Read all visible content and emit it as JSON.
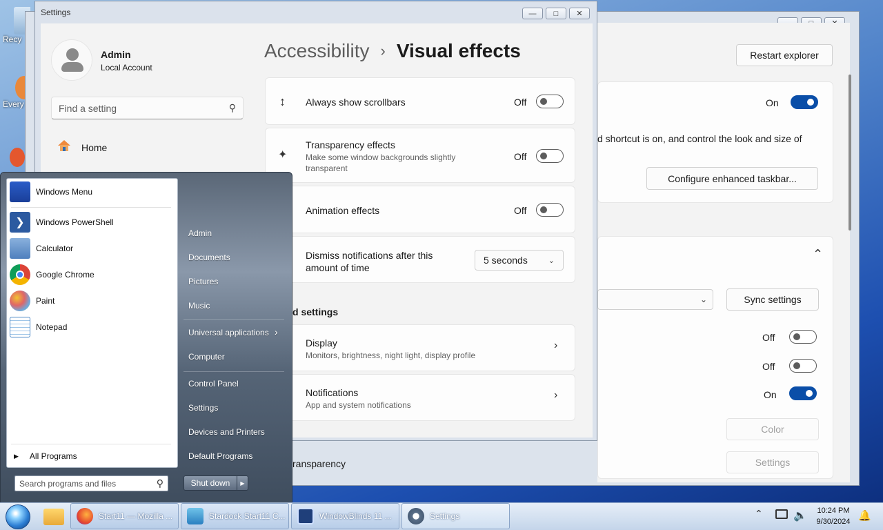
{
  "desktop": {
    "icons": [
      {
        "label": "Recy"
      },
      {
        "label": "Every"
      }
    ]
  },
  "back_window": {
    "restart_label": "Restart explorer",
    "toggle1_state": "On",
    "desc_text": "d shortcut is on, and control the look and size of",
    "configure_label": "Configure enhanced taskbar...",
    "sync_label": "Sync settings",
    "row1_state": "Off",
    "row2_state": "Off",
    "row3_state": "On",
    "color_label": "Color",
    "settings_label": "Settings",
    "transparency_label": "ransparency",
    "section_label": "d settings"
  },
  "settings": {
    "window_title": "Settings",
    "user": {
      "name": "Admin",
      "account": "Local Account"
    },
    "search": {
      "placeholder": "Find a setting"
    },
    "nav": {
      "home": "Home"
    },
    "breadcrumb": {
      "parent": "Accessibility",
      "sep": "›",
      "current": "Visual effects"
    },
    "rows": [
      {
        "title": "Always show scrollbars",
        "state": "Off"
      },
      {
        "title": "Transparency effects",
        "subtitle": "Make some window backgrounds slightly transparent",
        "state": "Off"
      },
      {
        "title": "Animation effects",
        "state": "Off"
      },
      {
        "title": "Dismiss notifications after this amount of time",
        "value": "5 seconds"
      }
    ],
    "related": [
      {
        "title": "Display",
        "subtitle": "Monitors, brightness, night light, display profile"
      },
      {
        "title": "Notifications",
        "subtitle": "App and system notifications"
      }
    ]
  },
  "start_menu": {
    "pinned": [
      {
        "label": "Windows Menu"
      },
      {
        "label": "Windows PowerShell"
      },
      {
        "label": "Calculator"
      },
      {
        "label": "Google Chrome"
      },
      {
        "label": "Paint"
      },
      {
        "label": "Notepad"
      }
    ],
    "all_programs": "All Programs",
    "search_placeholder": "Search programs and files",
    "right": [
      {
        "label": "Admin"
      },
      {
        "label": "Documents"
      },
      {
        "label": "Pictures"
      },
      {
        "label": "Music"
      },
      {
        "label": "Universal applications"
      },
      {
        "label": "Computer"
      },
      {
        "label": "Control Panel"
      },
      {
        "label": "Settings"
      },
      {
        "label": "Devices and Printers"
      },
      {
        "label": "Default Programs"
      }
    ],
    "shutdown": "Shut down"
  },
  "taskbar": {
    "buttons": [
      {
        "label": "Start11 — Mozilla ..."
      },
      {
        "label": "Stardock Start11 C..."
      },
      {
        "label": "WindowBlinds 11 ..."
      },
      {
        "label": "Settings"
      }
    ],
    "time": "10:24 PM",
    "date": "9/30/2024"
  }
}
